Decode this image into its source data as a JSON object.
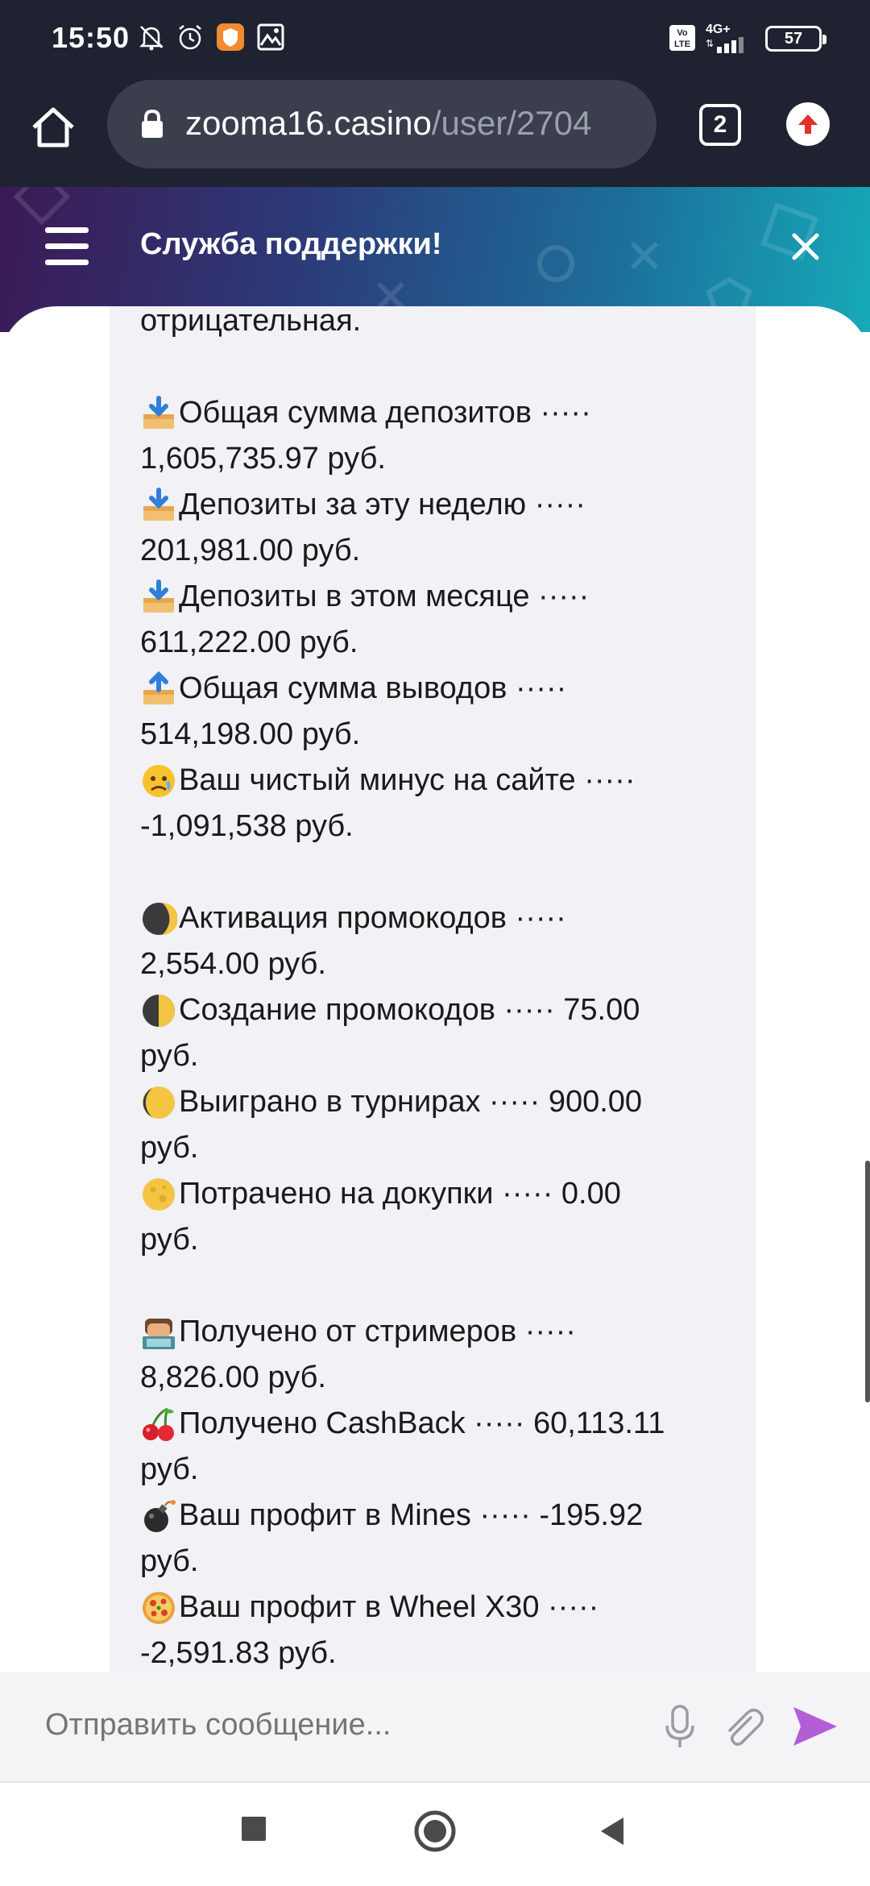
{
  "status_bar": {
    "time": "15:50",
    "network": "4G+",
    "volte": "Vo LTE",
    "battery": "57",
    "icons": [
      "mute-icon",
      "alarm-icon",
      "app-notification-icon",
      "gallery-icon",
      "signal-icon"
    ]
  },
  "browser": {
    "url_domain": "zooma16.casino",
    "url_path": "/user/2704",
    "tab_count": "2"
  },
  "chat": {
    "title": "Служба поддержки!",
    "input_placeholder": "Отправить сообщение...",
    "accent_color": "#b25fd6",
    "message_lines": [
      {
        "emoji": "",
        "text": "отрицательная."
      },
      {
        "emoji": "",
        "text": ""
      },
      {
        "emoji": "inbox-tray",
        "text": "Общая сумма депозитов ·····"
      },
      {
        "emoji": "",
        "text": "1,605,735.97 руб."
      },
      {
        "emoji": "inbox-tray",
        "text": "Депозиты за эту неделю ·····"
      },
      {
        "emoji": "",
        "text": "201,981.00 руб."
      },
      {
        "emoji": "inbox-tray",
        "text": "Депозиты в этом месяце ·····"
      },
      {
        "emoji": "",
        "text": "611,222.00 руб."
      },
      {
        "emoji": "outbox-tray",
        "text": "Общая сумма выводов ·····"
      },
      {
        "emoji": "",
        "text": "514,198.00 руб."
      },
      {
        "emoji": "sad-face",
        "text": "Ваш чистый минус на сайте ·····"
      },
      {
        "emoji": "",
        "text": "-1,091,538 руб."
      },
      {
        "emoji": "",
        "text": ""
      },
      {
        "emoji": "moon-crescent-dark",
        "text": "Активация промокодов ·····"
      },
      {
        "emoji": "",
        "text": "2,554.00 руб."
      },
      {
        "emoji": "moon-half",
        "text": "Создание промокодов ····· 75.00"
      },
      {
        "emoji": "",
        "text": "руб."
      },
      {
        "emoji": "moon-crescent-light",
        "text": "Выиграно в турнирах ····· 900.00"
      },
      {
        "emoji": "",
        "text": "руб."
      },
      {
        "emoji": "moon-full",
        "text": "Потрачено на докупки ····· 0.00"
      },
      {
        "emoji": "",
        "text": "руб."
      },
      {
        "emoji": "",
        "text": ""
      },
      {
        "emoji": "technologist",
        "text": "Получено от стримеров ·····"
      },
      {
        "emoji": "",
        "text": "8,826.00 руб."
      },
      {
        "emoji": "cherries",
        "text": "Получено CashBack ····· 60,113.11"
      },
      {
        "emoji": "",
        "text": "руб."
      },
      {
        "emoji": "bomb",
        "text": "Ваш профит в Mines ····· -195.92"
      },
      {
        "emoji": "",
        "text": "руб."
      },
      {
        "emoji": "pizza-wheel",
        "text": "Ваш профит в Wheel X30 ·····"
      },
      {
        "emoji": "",
        "text": "-2,591.83 руб."
      }
    ]
  }
}
